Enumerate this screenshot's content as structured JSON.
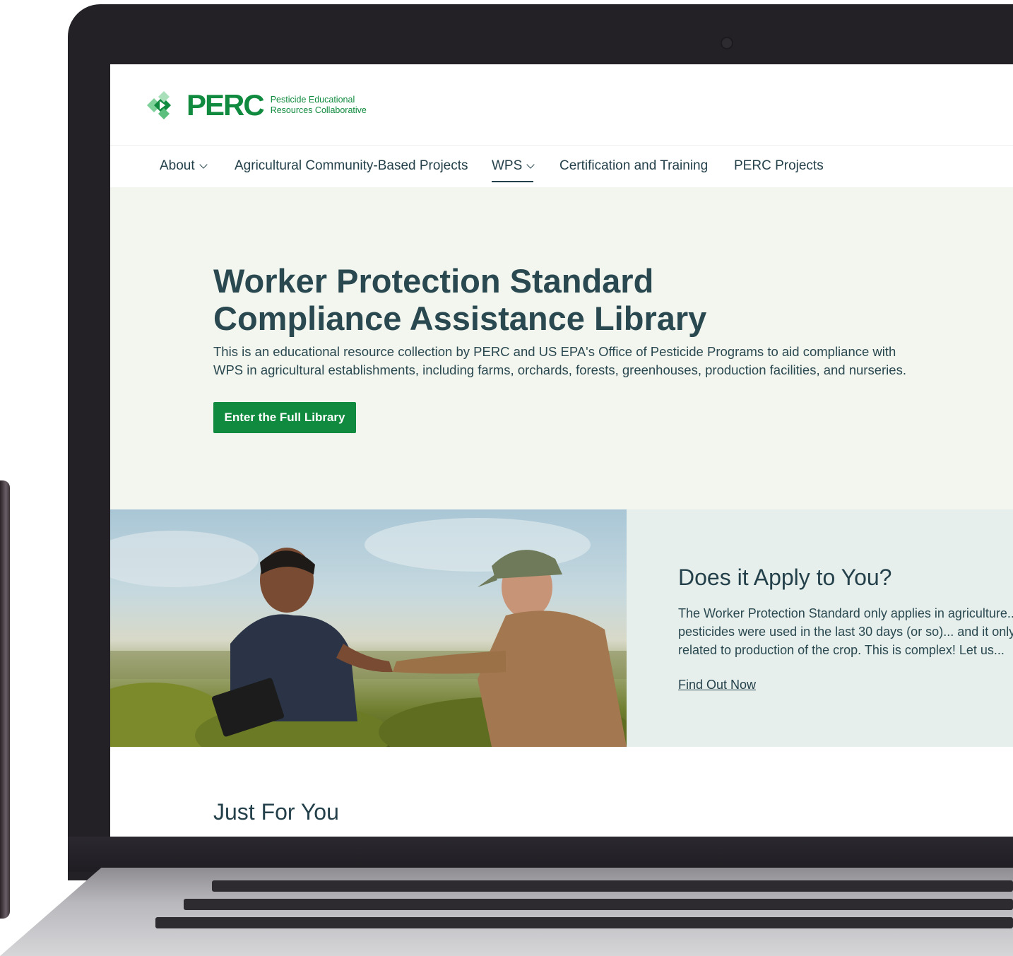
{
  "site": {
    "logo_word": "PERC",
    "logo_tagline_1": "Pesticide Educational",
    "logo_tagline_2": "Resources Collaborative"
  },
  "nav": {
    "items": [
      {
        "label": "About",
        "has_dropdown": true
      },
      {
        "label": "Agricultural Community-Based Projects",
        "has_dropdown": false
      },
      {
        "label": "WPS",
        "has_dropdown": true,
        "active": true
      },
      {
        "label": "Certification and Training",
        "has_dropdown": false
      },
      {
        "label": "PERC Projects",
        "has_dropdown": false
      }
    ]
  },
  "hero": {
    "title": "Worker Protection Standard Compliance Assistance Library",
    "description": "This is an educational resource collection by PERC and US EPA's Office of Pesticide Programs to aid compliance with WPS in agricultural establishments, including farms, orchards, forests, greenhouses, production facilities, and nurseries.",
    "button_label": "Enter the Full Library"
  },
  "feature": {
    "title": "Does it Apply to You?",
    "description": "The Worker Protection Standard only applies in agriculture... pesticides were used in the last 30 days (or so)... and it only... related to production of the crop. This is complex! Let us...",
    "link_label": "Find Out Now"
  },
  "section": {
    "title": "Just For You"
  },
  "colors": {
    "brand_green": "#0f8a3e",
    "text_dark": "#24404a",
    "hero_bg": "#f3f6ef",
    "feature_bg": "#e6efeb"
  }
}
